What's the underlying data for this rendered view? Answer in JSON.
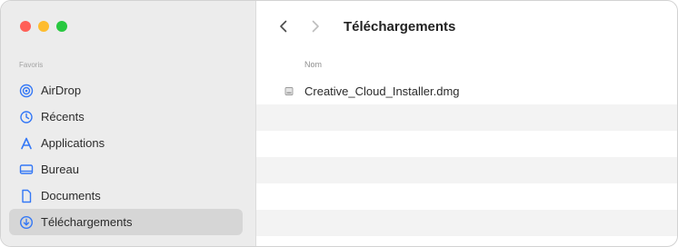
{
  "window": {
    "traffic_lights": {
      "close": "#ff5f57",
      "minimize": "#febc2e",
      "zoom": "#28c840"
    }
  },
  "sidebar": {
    "section_label": "Favoris",
    "items": [
      {
        "label": "AirDrop",
        "icon": "airdrop-icon",
        "active": false
      },
      {
        "label": "Récents",
        "icon": "clock-icon",
        "active": false
      },
      {
        "label": "Applications",
        "icon": "applications-icon",
        "active": false
      },
      {
        "label": "Bureau",
        "icon": "desktop-icon",
        "active": false
      },
      {
        "label": "Documents",
        "icon": "document-icon",
        "active": false
      },
      {
        "label": "Téléchargements",
        "icon": "download-icon",
        "active": true
      }
    ],
    "accent_color": "#3478f6"
  },
  "toolbar": {
    "back_icon": "chevron-left-icon",
    "forward_icon": "chevron-right-icon",
    "title": "Téléchargements"
  },
  "file_list": {
    "column_name": "Nom",
    "files": [
      {
        "name": "Creative_Cloud_Installer.dmg",
        "icon": "disk-image-icon"
      }
    ]
  }
}
